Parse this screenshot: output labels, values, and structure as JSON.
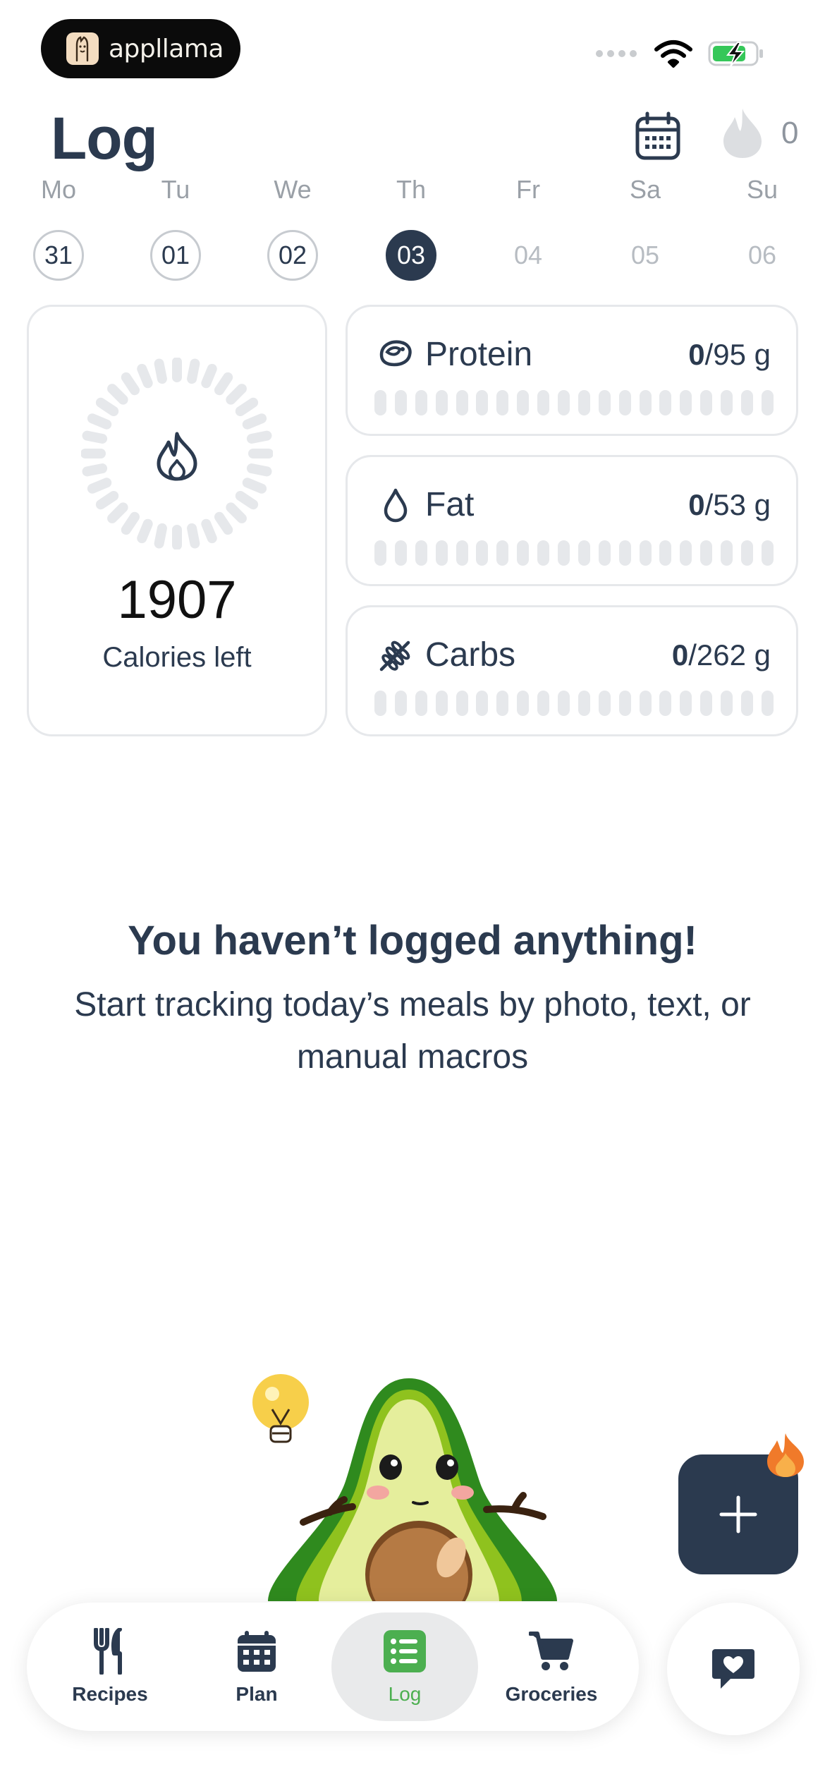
{
  "brand": {
    "name": "appllama"
  },
  "header": {
    "title": "Log",
    "streak_count": "0"
  },
  "week": [
    {
      "label": "Mo",
      "date": "31",
      "state": "past"
    },
    {
      "label": "Tu",
      "date": "01",
      "state": "past"
    },
    {
      "label": "We",
      "date": "02",
      "state": "past"
    },
    {
      "label": "Th",
      "date": "03",
      "state": "selected"
    },
    {
      "label": "Fr",
      "date": "04",
      "state": "future"
    },
    {
      "label": "Sa",
      "date": "05",
      "state": "future"
    },
    {
      "label": "Su",
      "date": "06",
      "state": "future"
    }
  ],
  "calories": {
    "value": "1907",
    "label": "Calories left"
  },
  "macros": [
    {
      "name": "Protein",
      "consumed": "0",
      "target": "/95 g",
      "icon": "steak-icon"
    },
    {
      "name": "Fat",
      "consumed": "0",
      "target": "/53 g",
      "icon": "droplet-icon"
    },
    {
      "name": "Carbs",
      "consumed": "0",
      "target": "/262 g",
      "icon": "wheat-icon"
    }
  ],
  "empty_state": {
    "title": "You haven’t logged anything!",
    "subtitle": "Start tracking today’s meals by photo, text, or manual macros"
  },
  "tabs": [
    {
      "label": "Recipes",
      "icon": "fork-knife-icon"
    },
    {
      "label": "Plan",
      "icon": "calendar-icon"
    },
    {
      "label": "Log",
      "icon": "list-icon",
      "active": true
    },
    {
      "label": "Groceries",
      "icon": "cart-icon"
    }
  ],
  "colors": {
    "primary": "#2b3a4f",
    "accent_green": "#4caf50",
    "muted": "#e6e8eb",
    "flame": "#f07a2a"
  }
}
